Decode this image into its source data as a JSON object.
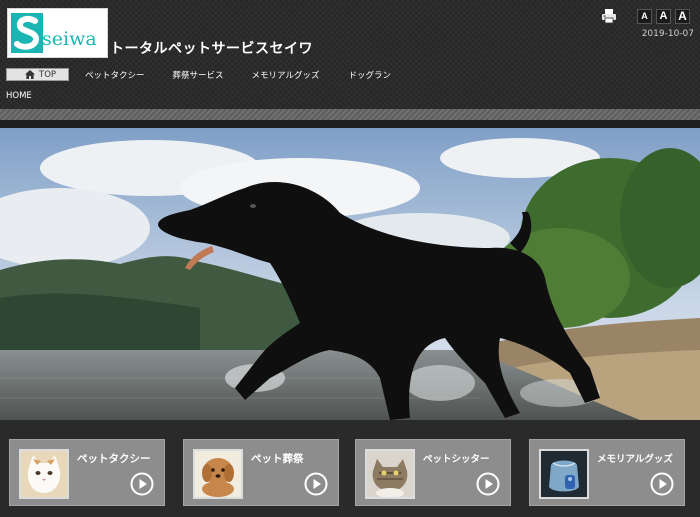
{
  "header": {
    "logo_text": "seiwa",
    "site_title": "トータルペットサービスセイワ",
    "date": "2019-10-07",
    "font_sizes": [
      "A",
      "A",
      "A"
    ]
  },
  "nav": {
    "items": [
      {
        "label": "TOP",
        "icon": "home-icon"
      },
      {
        "label": "ペットタクシー"
      },
      {
        "label": "葬祭サービス"
      },
      {
        "label": "メモリアルグッズ"
      },
      {
        "label": "ドッグラン"
      }
    ]
  },
  "breadcrumb": "HOME",
  "hero": {
    "subject": "black-dog-running-in-lake"
  },
  "tiles": [
    {
      "label": "ペットタクシー",
      "thumb": "cat-photo"
    },
    {
      "label": "ペット葬祭",
      "thumb": "puppy-figurine-photo"
    },
    {
      "label": "ペットシッター",
      "thumb": "kitten-photo"
    },
    {
      "label": "メモリアルグッズ",
      "thumb": "memorial-pouch-photo"
    }
  ],
  "colors": {
    "background": "#2b2b2b",
    "tile": "#8d8d8d",
    "logo_accent": "#1bb6b3"
  }
}
